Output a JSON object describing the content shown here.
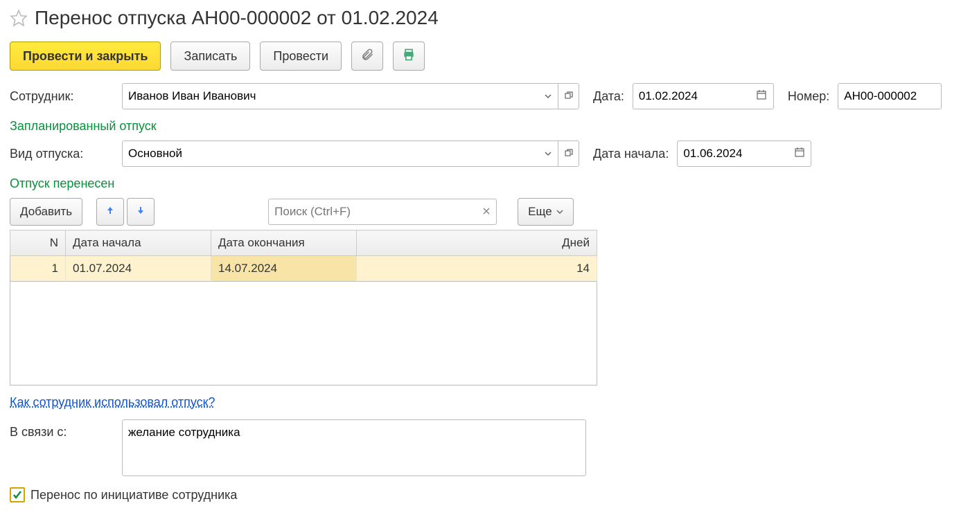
{
  "title": "Перенос отпуска АН00-000002 от 01.02.2024",
  "toolbar": {
    "post_close": "Провести и закрыть",
    "save": "Записать",
    "post": "Провести"
  },
  "labels": {
    "employee": "Сотрудник:",
    "date": "Дата:",
    "number": "Номер:",
    "planned": "Запланированный отпуск",
    "vac_type": "Вид отпуска:",
    "start_date": "Дата начала:",
    "moved": "Отпуск перенесен",
    "add": "Добавить",
    "more": "Еще",
    "search_ph": "Поиск (Ctrl+F)",
    "link": "Как сотрудник использовал отпуск?",
    "reason": "В связи с:",
    "by_employee": "Перенос по инициативе сотрудника"
  },
  "fields": {
    "employee": "Иванов Иван Иванович",
    "date": "01.02.2024",
    "number": "АН00-000002",
    "vac_type": "Основной",
    "start_date": "01.06.2024",
    "reason": "желание сотрудника"
  },
  "table": {
    "cols": {
      "n": "N",
      "start": "Дата начала",
      "end": "Дата окончания",
      "days": "Дней"
    },
    "rows": [
      {
        "n": "1",
        "start": "01.07.2024",
        "end": "14.07.2024",
        "days": "14"
      }
    ]
  },
  "checked": true
}
